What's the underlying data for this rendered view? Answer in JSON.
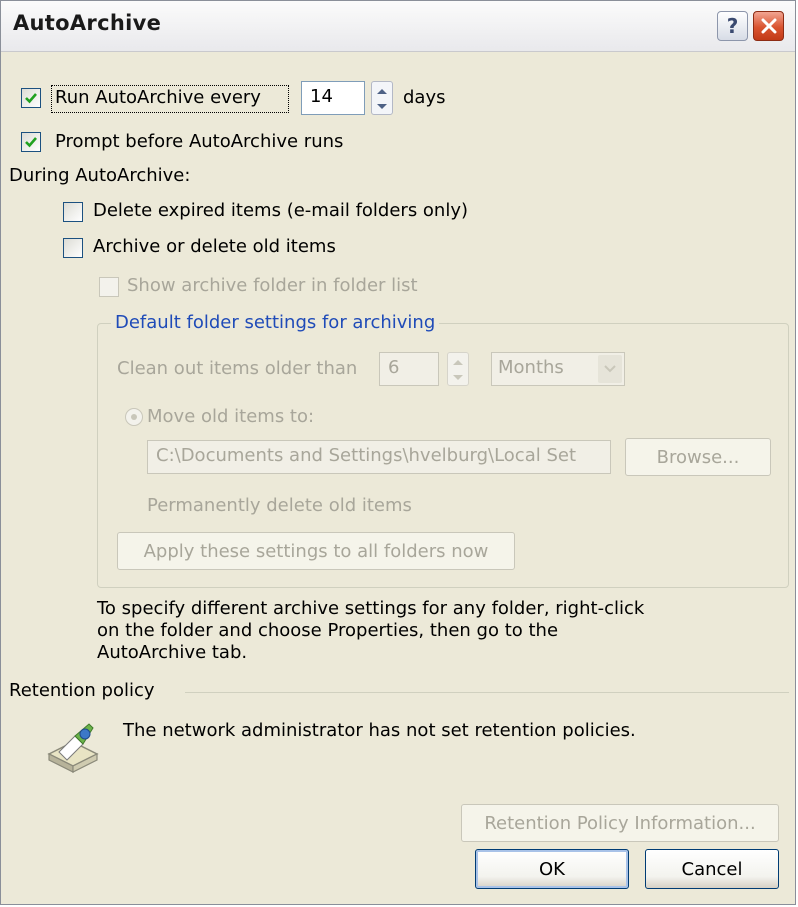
{
  "window": {
    "title": "AutoArchive",
    "help_glyph": "?",
    "close_icon": "close-icon"
  },
  "general": {
    "run_every_label": "Run AutoArchive every",
    "run_every_checked": true,
    "days_value": "14",
    "days_label": "days",
    "prompt_label": "Prompt before AutoArchive runs",
    "prompt_checked": true,
    "during_label": "During AutoArchive:",
    "delete_expired_label": "Delete expired items (e-mail folders only)",
    "delete_expired_checked": false,
    "archive_old_label": "Archive or delete old items",
    "archive_old_checked": false,
    "show_folder_label": "Show archive folder in folder list"
  },
  "defaults": {
    "legend": "Default folder settings for archiving",
    "clean_out_label": "Clean out items older than",
    "age_value": "6",
    "age_unit": "Months",
    "move_label": "Move old items to:",
    "path_value": "C:\\Documents and Settings\\hvelburg\\Local Set",
    "browse_label": "Browse...",
    "permanently_delete_label": "Permanently delete old items",
    "apply_label": "Apply these settings to all folders now"
  },
  "info_text": [
    "To specify different archive settings for any folder, right-click",
    "on the folder and choose Properties, then go to the",
    "AutoArchive tab."
  ],
  "retention": {
    "legend": "Retention policy",
    "icon": "retention-policy-icon",
    "message": "The network administrator has not set retention policies.",
    "info_button": "Retention Policy Information..."
  },
  "footer": {
    "ok_label": "OK",
    "cancel_label": "Cancel"
  },
  "colors": {
    "dialog_bg": "#ece9d8",
    "legend_blue": "#1f4bb8",
    "disabled_text": "#a8a69a",
    "close_red": "#d9532f"
  }
}
